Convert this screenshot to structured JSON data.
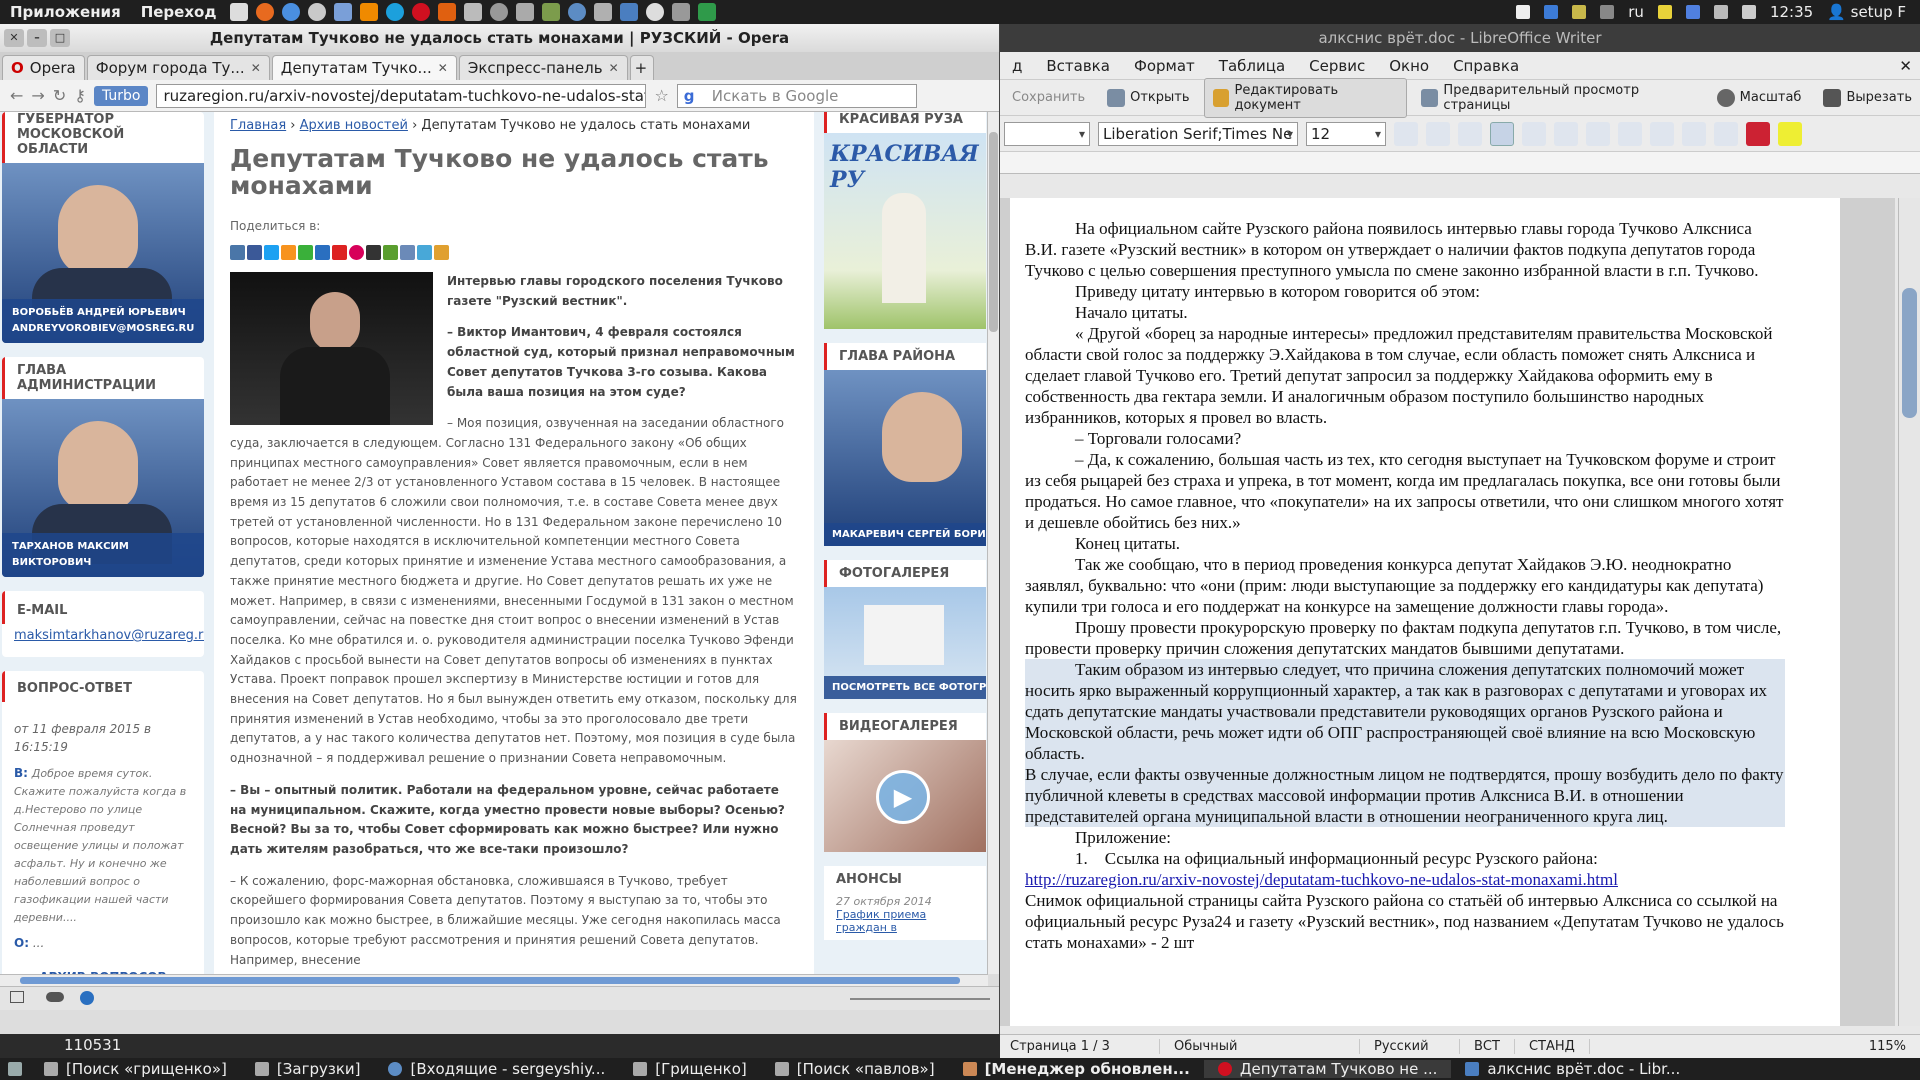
{
  "top_panel": {
    "menu_apps": "Приложения",
    "menu_go": "Переход",
    "lang": "ru",
    "time": "12:35",
    "user": "setup F"
  },
  "writer": {
    "title": "алкснис врёт.doc - LibreOffice Writer",
    "menu": [
      "д",
      "Вставка",
      "Формат",
      "Таблица",
      "Сервис",
      "Окно",
      "Справка"
    ],
    "toolbar": {
      "save": "Сохранить",
      "open": "Открыть",
      "edit_doc": "Редактировать документ",
      "preview": "Предварительный просмотр страницы",
      "zoom": "Масштаб",
      "cut": "Вырезать"
    },
    "font_name": "Liberation Serif;Times Ne",
    "font_size": "12",
    "paragraphs": [
      {
        "text": "На официальном сайте Рузского района появилось интервью главы города Тучково Алксниса В.И. газете «Рузский вестник» в котором он утверждает о наличии фактов подкупа депутатов города Тучково с целью совершения преступного умысла по смене законно избранной власти в г.п. Тучково.",
        "indent": true,
        "selected": false
      },
      {
        "text": "Приведу цитату интервью в котором говорится об этом:",
        "indent": true,
        "selected": false
      },
      {
        "text": "Начало цитаты.",
        "indent": true,
        "selected": false
      },
      {
        "text": "« Другой «борец за народные интересы» предложил представителям правительства Московской области свой голос за поддержку Э.Хайдакова в том случае, если область поможет снять Алксниса и сделает главой Тучково его. Третий депутат запросил за поддержку Хайдакова оформить ему в собственность два гектара земли. И аналогичным образом поступило большинство народных избранников, которых я провел во власть.",
        "indent": true,
        "selected": false
      },
      {
        "text": "– Торговали голосами?",
        "indent": true,
        "selected": false
      },
      {
        "text": "– Да, к сожалению, большая часть из тех, кто сегодня выступает на Тучковском форуме и строит из себя рыцарей без страха и упрека, в тот момент, когда им предлагалась покупка, все они готовы были продаться. Но самое главное, что «покупатели» на их запросы ответили, что они слишком многого хотят и дешевле обойтись без них.»",
        "indent": true,
        "selected": false
      },
      {
        "text": " Конец цитаты.",
        "indent": true,
        "selected": false
      },
      {
        "text": "Так же сообщаю, что в период проведения конкурса депутат Хайдаков Э.Ю. неоднократно заявлял, буквально: что «они (прим: люди выступающие за поддержку его кандидатуры как депутата) купили три голоса и его поддержат на конкурсе на замещение должности главы города».",
        "indent": true,
        "selected": false
      },
      {
        "text": "Прошу провести прокурорскую проверку по фактам подкупа депутатов г.п. Тучково, в том числе, провести проверку причин сложения депутатских мандатов бывшими депутатами.",
        "indent": true,
        "selected": false
      },
      {
        "text": "Таким образом из интервью следует, что причина сложения депутатских полномочий может носить ярко выраженный коррупционный характер, а так как в разговорах с депутатами и уговорах их сдать депутатские мандаты участвовали представители руководящих органов Рузского района и Московской области, речь может идти об ОПГ распространяющей своё влияние на всю Московскую область.",
        "indent": true,
        "selected": true
      },
      {
        "text": "В случае, если факты озвученные должностным лицом не подтвердятся, прошу возбудить дело по факту публичной клеветы в средствах массовой информации против Алксниса В.И. в отношении представителей органа муниципальной власти в отношении неограниченного круга лиц.",
        "indent": false,
        "selected": true
      },
      {
        "text": "Приложение:",
        "indent": true,
        "selected": false
      },
      {
        "text": "1.    Ссылка на официальный информационный ресурс Рузского района:",
        "indent": true,
        "selected": false
      }
    ],
    "link": "http://ruzaregion.ru/arxiv-novostej/deputatam-tuchkovo-ne-udalos-stat-monaxami.html",
    "after_link": "Снимок официальной страницы сайта Рузского района со статьёй об интервью Алксниса со ссылкой на официальный ресурс Руза24 и газету «Рузский вестник», под названием «Депутатам Тучково не удалось стать монахами» - 2 шт",
    "status": {
      "page": "Страница 1 / 3",
      "style": "Обычный",
      "lang": "Русский",
      "mode1": "ВСТ",
      "mode2": "СТАНД",
      "zoom": "115%"
    }
  },
  "opera": {
    "title": "Депутатам Тучково не удалось стать монахами | РУЗСКИЙ - Opera",
    "menu_button": "Opera",
    "tabs": [
      "Форум города Ту...",
      "Депутатам Тучко...",
      "Экспресс-панель"
    ],
    "turbo": "Turbo",
    "url": "ruzaregion.ru/arxiv-novostej/deputatam-tuchkovo-ne-udalos-stat-mc",
    "search_placeholder": "Искать в Google",
    "left": {
      "governor_head": "ГУБЕРНАТОР МОСКОВСКОЙ ОБЛАСТИ",
      "governor_cap": "ВОРОБЬЁВ АНДРЕЙ ЮРЬЕВИЧ ANDREYVOROBIEV@MOSREG.RU",
      "admin_head": "ГЛАВА АДМИНИСТРАЦИИ",
      "admin_cap": "ТАРХАНОВ МАКСИМ ВИКТОРОВИЧ",
      "email_head": "E-MAIL",
      "email": "maksimtarkhanov@ruzareg.ru",
      "qa_head": "ВОПРОС-ОТВЕТ",
      "qa_date": "от 11 февраля 2015 в 16:15:19",
      "qa_q_label": "В:",
      "qa_q": "Доброе время суток. Скажите пожалуйста когда в д.Нестерово по улице Солнечная проведут освещение улицы и положат асфальт. Ну и конечно же наболевший вопрос о газофикации нашей части деревни....",
      "qa_a_label": "О:",
      "qa_a": "...",
      "archive": "АРХИВ ВОПРОСОВ"
    },
    "center": {
      "bc_home": "Главная",
      "bc_archive": "Архив новостей",
      "bc_current": "Депутатам Тучково не удалось стать монахами",
      "heading": "Депутатам Тучково не удалось стать монахами",
      "share": "Поделиться в:",
      "lead1": "Интервью главы городского поселения Тучково газете \"Рузский вестник\".",
      "lead2": "– Виктор Имантович, 4 февраля состоялся областной суд, который признал неправомочным Совет депутатов Тучкова 3-го созыва. Какова была ваша позиция на этом суде?",
      "para1": "– Моя позиция, озвученная на заседании областного суда, заключается в следующем. Согласно 131 Федерального закону «Об общих принципах местного самоуправления» Совет является правомочным, если в нем работает не менее 2/3 от установленного Уставом состава в 15 человек. В настоящее время из 15 депутатов 6 сложили свои полномочия, т.е. в составе Совета менее двух третей от установленной численности. Но в 131 Федеральном законе перечислено 10 вопросов, которые находятся в исключительной компетенции местного Совета депутатов, среди которых принятие и изменение Устава местного самообразования, а также принятие местного бюджета и другие. Но Совет депутатов решать их уже не может. Например, в связи с изменениями, внесенными Госдумой в 131 закон о местном самоуправлении, сейчас на повестке дня стоит вопрос о внесении изменений в Устав поселка. Ко мне обратился и. о. руководителя администрации поселка Тучково Эфенди Хайдаков с просьбой вынести на Совет депутатов вопросы об изменениях в пунктах Устава. Проект поправок прошел экспертизу в Министерстве юстиции и готов для внесения на Совет депутатов. Но я был вынужден ответить ему отказом, поскольку для принятия изменений в Устав необходимо, чтобы за это проголосовало две трети депутатов, а у нас такого количества депутатов нет. Поэтому, моя позиция в суде была однозначной – я поддерживал решение о признании Совета неправомочным.",
      "q2": "– Вы – опытный политик. Работали на федеральном уровне, сейчас работаете на муниципальном. Скажите, когда уместно провести новые выборы? Осенью? Весной? Вы за то, чтобы Совет сформировать как можно быстрее? Или нужно дать жителям разобраться, что же все-таки произошло?",
      "para2": "– К сожалению, форс-мажорная обстановка, сложившаяся в Тучково, требует скорейшего формирования Совета депутатов. Поэтому я выступаю за то, чтобы это произошло как можно быстрее, в ближайшие месяцы. Уже сегодня накопилась масса вопросов, которые требуют рассмотрения и принятия решений Совета депутатов. Например, внесение"
    },
    "right": {
      "ruza_head": "КРАСИВАЯ РУЗА",
      "ruza_banner": "КРАСИВАЯ РУ",
      "head_district": "ГЛАВА РАЙОНА",
      "district_cap": "МАКАРЕВИЧ СЕРГЕЙ БОРИСОВИЧ",
      "photo_head": "ФОТОГАЛЕРЕЯ",
      "photo_cap": "ПОСМОТРЕТЬ ВСЕ ФОТОГРАФИИ",
      "video_head": "ВИДЕОГАЛЕРЕЯ",
      "anons_head": "АНОНСЫ",
      "anons_date": "27 октября 2014",
      "anons_link": "График приема граждан в"
    }
  },
  "desktop_number": "110531",
  "taskbar": [
    "[Поиск «грищенко»]",
    "[Загрузки]",
    "[Входящие - sergeyshiy...",
    "[Грищенко]",
    "[Поиск «павлов»]",
    "[Менеджер обновлен...",
    "Депутатам Тучково не ...",
    "алкснис врёт.doc - Libr..."
  ]
}
